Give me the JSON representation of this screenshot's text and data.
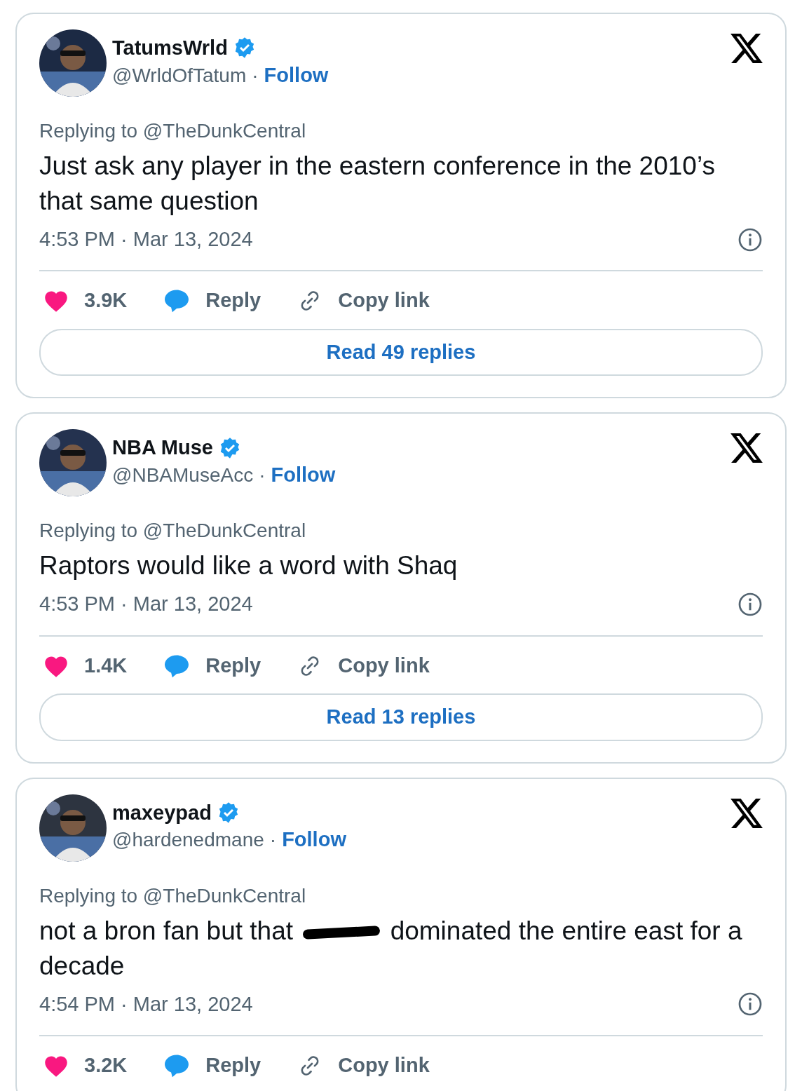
{
  "tweets": [
    {
      "display_name": "TatumsWrld",
      "verified": true,
      "handle": "@WrldOfTatum",
      "separator": "·",
      "follow": "Follow",
      "replying_to": "Replying to @TheDunkCentral",
      "body": [
        {
          "kind": "text",
          "text": "Just ask any player in the eastern conference in the 2010’s that same question"
        }
      ],
      "time": "4:53 PM · Mar 13, 2024",
      "likes": "3.9K",
      "reply": "Reply",
      "copy_link": "Copy link",
      "read_replies": "Read 49 replies"
    },
    {
      "display_name": "NBA Muse",
      "verified": true,
      "handle": "@NBAMuseAcc",
      "separator": "·",
      "follow": "Follow",
      "replying_to": "Replying to @TheDunkCentral",
      "body": [
        {
          "kind": "text",
          "text": "Raptors would like a word with Shaq"
        }
      ],
      "time": "4:53 PM · Mar 13, 2024",
      "likes": "1.4K",
      "reply": "Reply",
      "copy_link": "Copy link",
      "read_replies": "Read 13 replies"
    },
    {
      "display_name": "maxeypad",
      "verified": true,
      "handle": "@hardenedmane",
      "separator": "·",
      "follow": "Follow",
      "replying_to": "Replying to @TheDunkCentral",
      "body": [
        {
          "kind": "text",
          "text": "not a bron fan but that"
        },
        {
          "kind": "redaction"
        },
        {
          "kind": "text",
          "text": "dominated the entire east for a decade"
        }
      ],
      "time": "4:54 PM · Mar 13, 2024",
      "likes": "3.2K",
      "reply": "Reply",
      "copy_link": "Copy link"
    }
  ]
}
